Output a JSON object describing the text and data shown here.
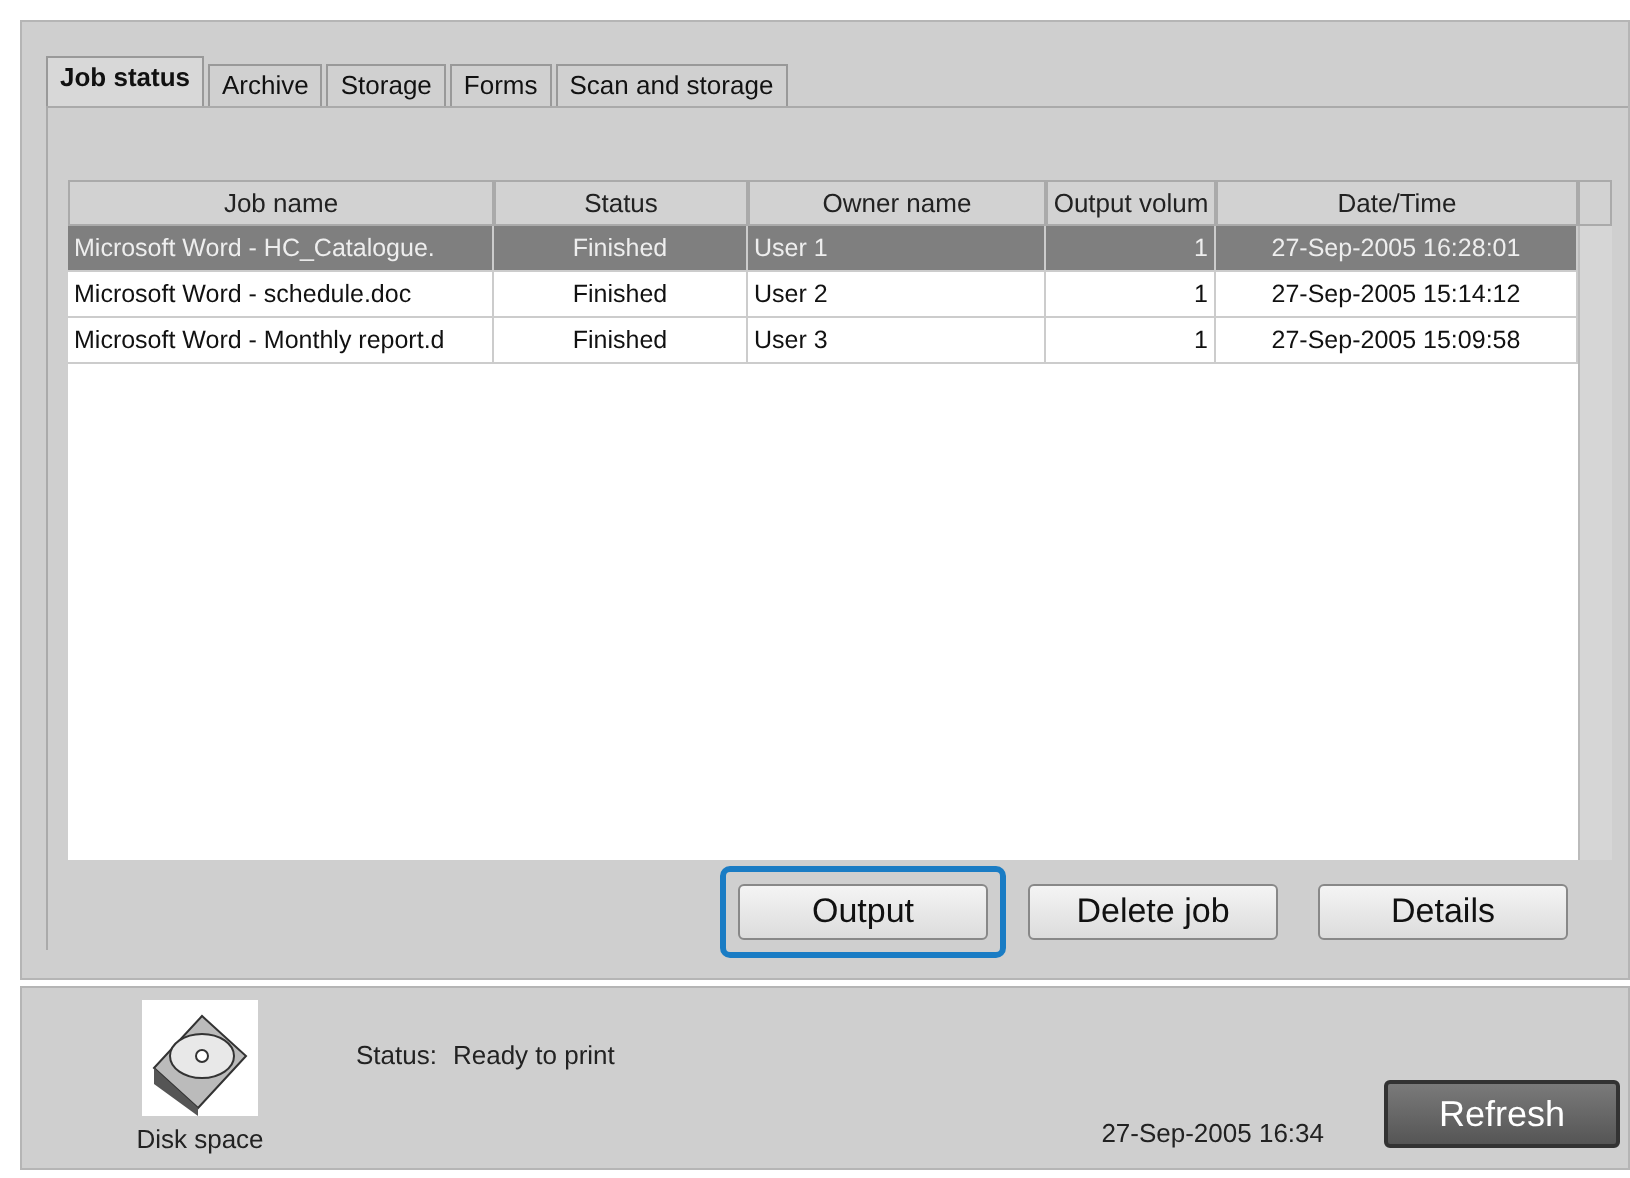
{
  "tabs": [
    {
      "label": "Job status",
      "selected": true
    },
    {
      "label": "Archive",
      "selected": false
    },
    {
      "label": "Storage",
      "selected": false
    },
    {
      "label": "Forms",
      "selected": false
    },
    {
      "label": "Scan and storage",
      "selected": false
    }
  ],
  "table": {
    "columns": [
      "Job name",
      "Status",
      "Owner name",
      "Output volum",
      "Date/Time"
    ],
    "rows": [
      {
        "cells": [
          "Microsoft Word - HC_Catalogue.",
          "Finished",
          "User 1",
          "1",
          "27-Sep-2005 16:28:01"
        ],
        "selected": true
      },
      {
        "cells": [
          "Microsoft Word - schedule.doc",
          "Finished",
          "User 2",
          "1",
          "27-Sep-2005 15:14:12"
        ],
        "selected": false
      },
      {
        "cells": [
          "Microsoft Word - Monthly report.d",
          "Finished",
          "User 3",
          "1",
          "27-Sep-2005 15:09:58"
        ],
        "selected": false
      }
    ]
  },
  "buttons": [
    {
      "label": "Output",
      "highlighted": true
    },
    {
      "label": "Delete job",
      "highlighted": false
    },
    {
      "label": "Details",
      "highlighted": false
    }
  ],
  "status_bar": {
    "disk_label": "Disk space",
    "status_label": "Status:",
    "status_value": "Ready to print",
    "datetime": "27-Sep-2005 16:34",
    "refresh": "Refresh"
  }
}
